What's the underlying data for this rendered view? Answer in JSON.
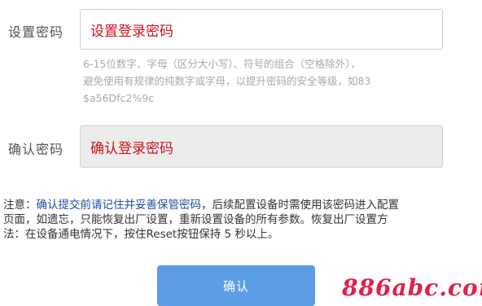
{
  "password": {
    "label": "设置密码",
    "value": "设置登录密码",
    "hint_lines": [
      "6-15位数字、字母（区分大小写）、符号的组合（空格除外），",
      "避免使用有规律的纯数字或字母，以提升密码的安全等级，如83",
      "$a56Dfc2%9c"
    ]
  },
  "confirm_password": {
    "label": "确认密码",
    "value": "确认登录密码"
  },
  "note": {
    "prefix": "注意：",
    "emphasis": "确认提交前请记住并妥善保管密码",
    "line1_rest": "，后续配置设备时需使用该密码进入配置",
    "line2": "页面，如遗忘，只能恢复出厂设置，重新设置设备的所有参数。恢复出厂设置方",
    "line3": "法：在设备通电情况下，按住Reset按钮保持 5 秒以上。"
  },
  "submit_button": "确认",
  "watermark": "886abc.com",
  "colors": {
    "input_text": "#d0121b",
    "button_bg": "#5b9ee6",
    "emphasis_text": "#1a4fa0",
    "watermark": "#e0204f"
  }
}
